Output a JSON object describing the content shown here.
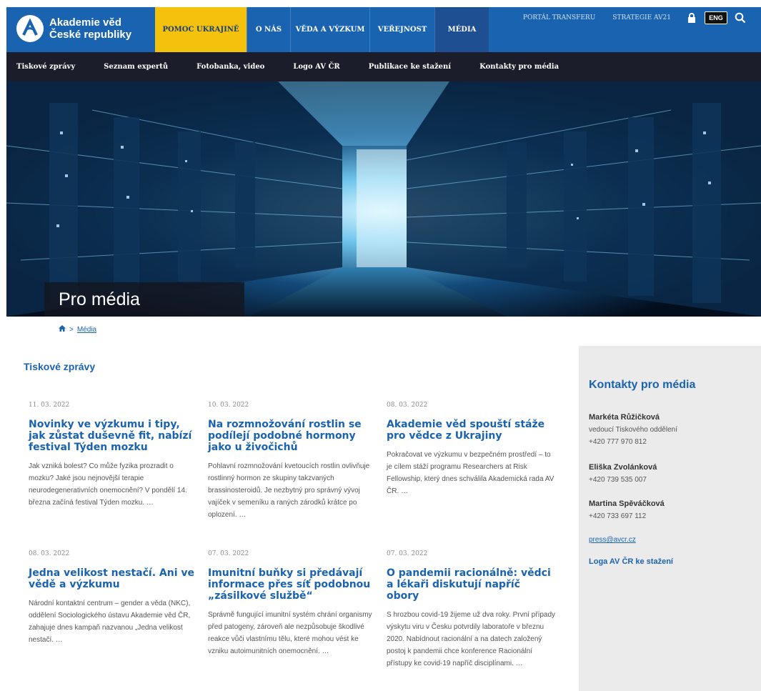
{
  "header": {
    "logo_line1": "Akademie věd",
    "logo_line2": "České republiky",
    "nav": [
      {
        "label": "Pomoc Ukrajině"
      },
      {
        "label": "O nás"
      },
      {
        "label": "Věda a výzkum"
      },
      {
        "label": "Veřejnost"
      },
      {
        "label": "Média"
      }
    ],
    "utility": {
      "portal_transfer": "Portál transferu",
      "strategie": "Strategie AV21",
      "lang": "ENG"
    },
    "colors": {
      "primary": "#1a63b0",
      "ukraine": "#f4c20d",
      "subnav": "#1b1e2a"
    }
  },
  "subnav": [
    "Tiskové zprávy",
    "Seznam expertů",
    "Fotobanka, video",
    "Logo AV ČR",
    "Publikace ke stažení",
    "Kontakty pro média"
  ],
  "hero": {
    "title": "Pro média"
  },
  "breadcrumb": {
    "home_icon": "home-icon",
    "current": "Média"
  },
  "press": {
    "section_title": "Tiskové zprávy",
    "articles": [
      {
        "date": "11. 03. 2022",
        "title": "Novinky ve výzkumu i tipy, jak zůstat duševně fit, nabízí festival Týden mozku",
        "excerpt": "Jak vzniká bolest? Co může fyzika prozradit o mozku? Jaké jsou nejnovější terapie neurodegenerativních onemocnění? V pondělí 14. března začíná festival Týden mozku. …"
      },
      {
        "date": "10. 03. 2022",
        "title": "Na rozmnožování rostlin se podílejí podobné hormony jako u živočichů",
        "excerpt": "Pohlavní rozmnožování kvetoucích rostlin ovlivňuje rostlinný hormon ze skupiny takzvaných brassinosteroidů. Je nezbytný pro správný vývoj vajíček v semeníku a raných zárodků krátce po oplození. …"
      },
      {
        "date": "08. 03. 2022",
        "title": "Akademie věd spouští stáže pro vědce z Ukrajiny",
        "excerpt": "Pokračovat ve výzkumu v bezpečném prostředí – to je cílem stáží programu Researchers at Risk Fellowship, který dnes schválila Akademická rada AV ČR. …"
      },
      {
        "date": "08. 03. 2022",
        "title": "Jedna velikost nestačí. Ani ve vědě a výzkumu",
        "excerpt": "Národní kontaktní centrum – gender a věda (NKC), oddělení Sociologického ústavu Akademie věd ČR, zahajuje dnes kampaň nazvanou „Jedna velikost nestačí. …"
      },
      {
        "date": "07. 03. 2022",
        "title": "Imunitní buňky si předávají informace přes síť podobnou „zásilkové službě“",
        "excerpt": "Správně fungující imunitní systém chrání organismy před patogeny, zároveň ale nezpůsobuje škodlivé reakce vůči vlastnímu tělu, které mohou vést ke vzniku autoimunitních onemocnění. …"
      },
      {
        "date": "07. 03. 2022",
        "title": "O pandemii racionálně: vědci a lékaři diskutují napříč obory",
        "excerpt": "S hrozbou covid-19 žijeme už dva roky. První případy výskytu viru v Česku potvrdily laboratoře v březnu 2020. Nabídnout racionální a na datech založený postoj k pandemii chce konference Racionální přístupy ke covid-19 napříč disciplínami. …"
      }
    ]
  },
  "sidebar": {
    "title": "Kontakty pro média",
    "contacts": [
      {
        "name": "Markéta Růžičková",
        "role": "vedoucí Tiskového oddělení",
        "phone": "+420 777 970 812"
      },
      {
        "name": "Eliška Zvolánková",
        "role": "",
        "phone": "+420 739 535 007"
      },
      {
        "name": "Martina Spěváčková",
        "role": "",
        "phone": "+420 733 697 112"
      }
    ],
    "email": "press@avcr.cz",
    "logos_link": "Loga AV ČR ke stažení"
  }
}
